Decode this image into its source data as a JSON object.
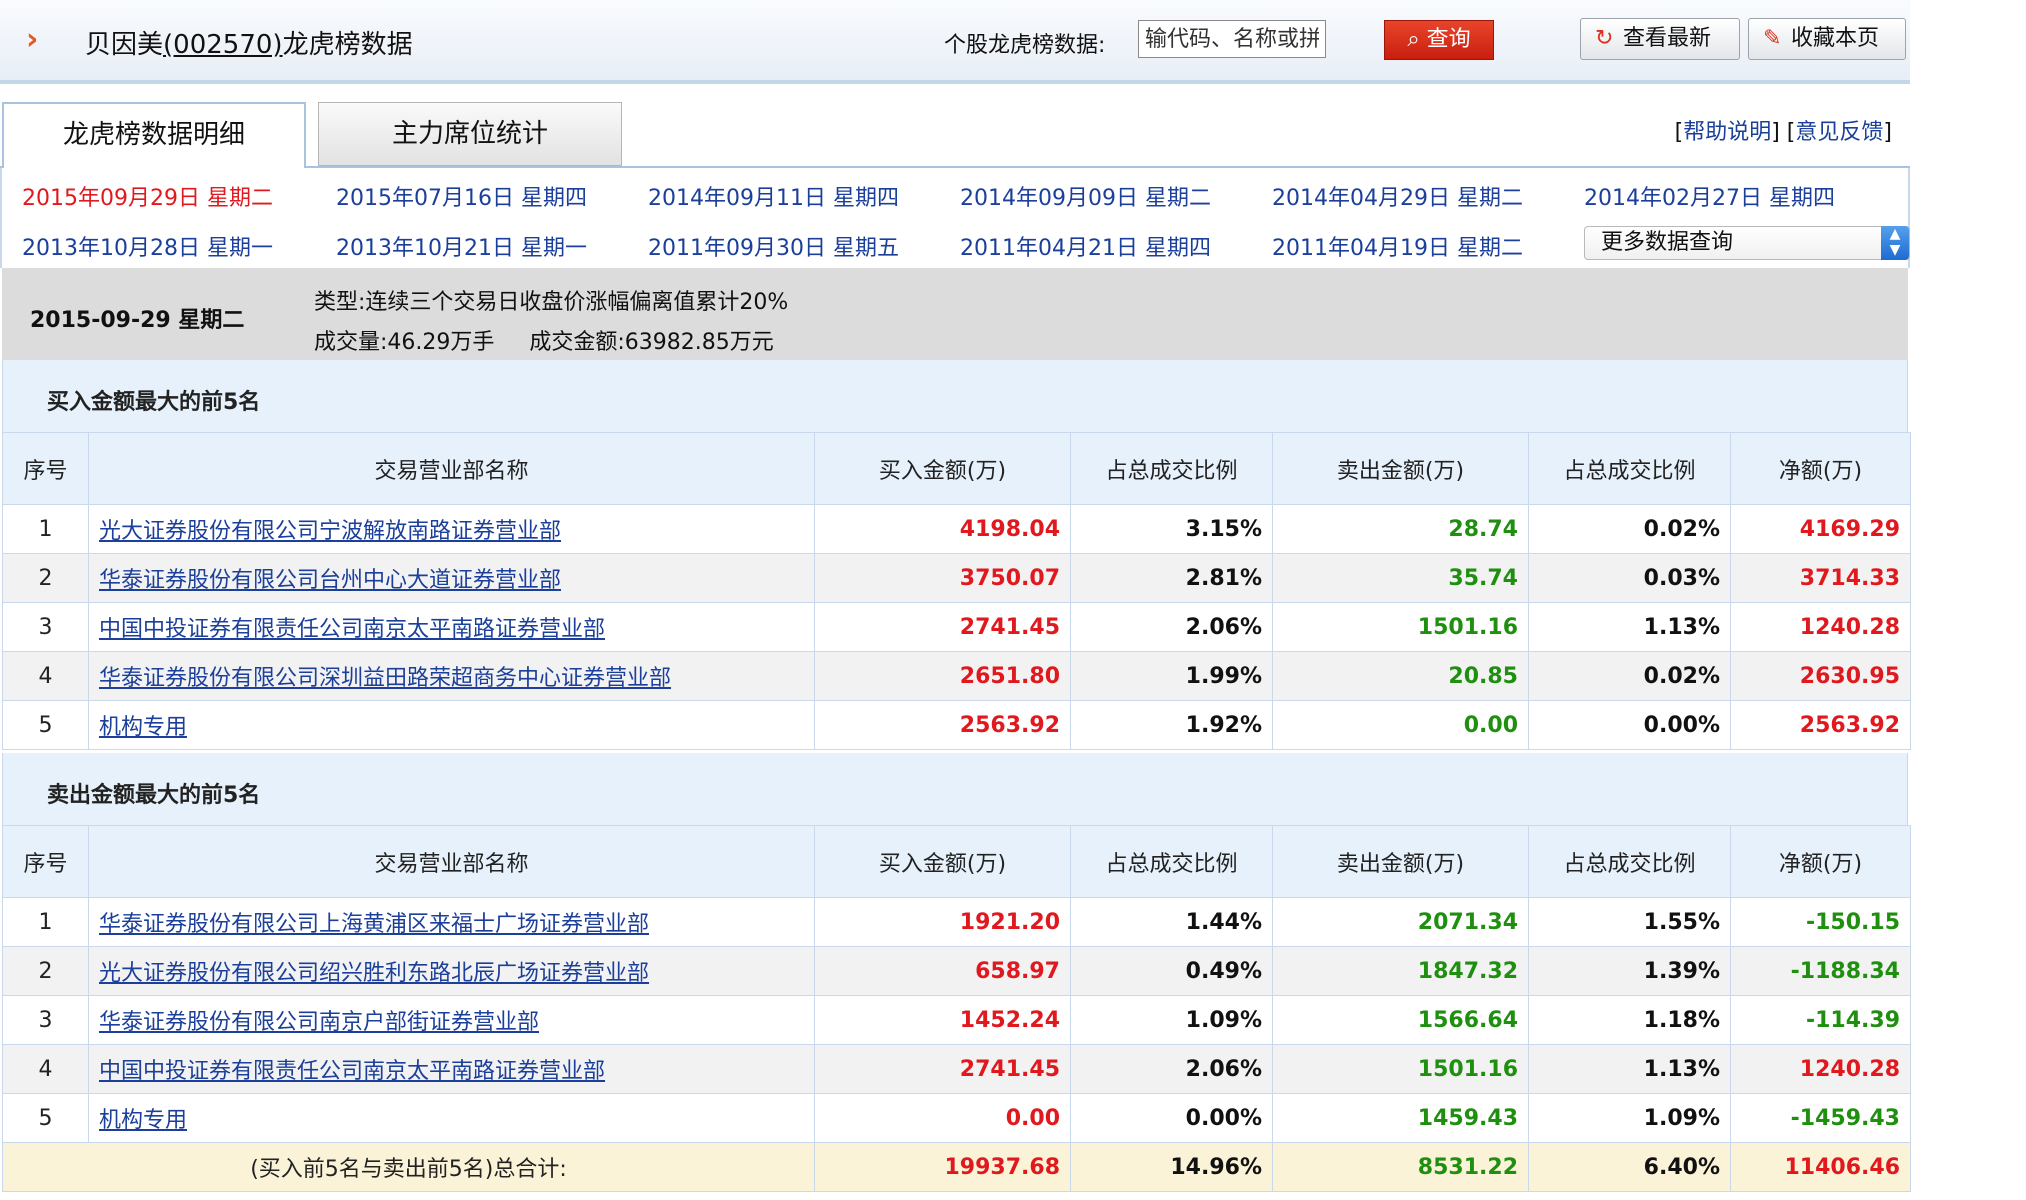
{
  "header": {
    "stock_name": "贝因美",
    "stock_code_paren": "(002570)",
    "title_suffix": "龙虎榜数据",
    "query_label": "个股龙虎榜数据:",
    "query_placeholder": "输代码、名称或拼音",
    "query_button": "查询",
    "refresh_button": "查看最新",
    "bookmark_button": "收藏本页"
  },
  "tabs": [
    {
      "label": "龙虎榜数据明细",
      "active": true
    },
    {
      "label": "主力席位统计",
      "active": false
    }
  ],
  "help": {
    "help_link": "帮助说明",
    "feedback_link": "意见反馈"
  },
  "dates": [
    "2015年09月29日 星期二",
    "2015年07月16日 星期四",
    "2014年09月11日 星期四",
    "2014年09月09日 星期二",
    "2014年04月29日 星期二",
    "2014年02月27日 星期四",
    "2013年10月28日 星期一",
    "2013年10月21日 星期一",
    "2011年09月30日 星期五",
    "2011年04月21日 星期四",
    "2011年04月19日 星期二"
  ],
  "more_select": "更多数据查询",
  "info": {
    "date": "2015-09-29 星期二",
    "type_line": "类型:连续三个交易日收盘价涨幅偏离值累计20%",
    "volume_line": "成交量:46.29万手     成交金额:63982.85万元"
  },
  "columns": [
    "序号",
    "交易营业部名称",
    "买入金额(万)",
    "占总成交比例",
    "卖出金额(万)",
    "占总成交比例",
    "净额(万)"
  ],
  "buy_section": {
    "title": "买入金额最大的前5名",
    "rows": [
      {
        "idx": "1",
        "name": "光大证券股份有限公司宁波解放南路证券营业部",
        "buy": "4198.04",
        "buy_pct": "3.15%",
        "sell": "28.74",
        "sell_pct": "0.02%",
        "net": "4169.29"
      },
      {
        "idx": "2",
        "name": "华泰证券股份有限公司台州中心大道证券营业部",
        "buy": "3750.07",
        "buy_pct": "2.81%",
        "sell": "35.74",
        "sell_pct": "0.03%",
        "net": "3714.33"
      },
      {
        "idx": "3",
        "name": "中国中投证券有限责任公司南京太平南路证券营业部",
        "buy": "2741.45",
        "buy_pct": "2.06%",
        "sell": "1501.16",
        "sell_pct": "1.13%",
        "net": "1240.28"
      },
      {
        "idx": "4",
        "name": "华泰证券股份有限公司深圳益田路荣超商务中心证券营业部",
        "buy": "2651.80",
        "buy_pct": "1.99%",
        "sell": "20.85",
        "sell_pct": "0.02%",
        "net": "2630.95"
      },
      {
        "idx": "5",
        "name": "机构专用",
        "buy": "2563.92",
        "buy_pct": "1.92%",
        "sell": "0.00",
        "sell_pct": "0.00%",
        "net": "2563.92"
      }
    ]
  },
  "sell_section": {
    "title": "卖出金额最大的前5名",
    "rows": [
      {
        "idx": "1",
        "name": "华泰证券股份有限公司上海黄浦区来福士广场证券营业部",
        "buy": "1921.20",
        "buy_pct": "1.44%",
        "sell": "2071.34",
        "sell_pct": "1.55%",
        "net": "-150.15"
      },
      {
        "idx": "2",
        "name": "光大证券股份有限公司绍兴胜利东路北辰广场证券营业部",
        "buy": "658.97",
        "buy_pct": "0.49%",
        "sell": "1847.32",
        "sell_pct": "1.39%",
        "net": "-1188.34"
      },
      {
        "idx": "3",
        "name": "华泰证券股份有限公司南京户部街证券营业部",
        "buy": "1452.24",
        "buy_pct": "1.09%",
        "sell": "1566.64",
        "sell_pct": "1.18%",
        "net": "-114.39"
      },
      {
        "idx": "4",
        "name": "中国中投证券有限责任公司南京太平南路证券营业部",
        "buy": "2741.45",
        "buy_pct": "2.06%",
        "sell": "1501.16",
        "sell_pct": "1.13%",
        "net": "1240.28"
      },
      {
        "idx": "5",
        "name": "机构专用",
        "buy": "0.00",
        "buy_pct": "0.00%",
        "sell": "1459.43",
        "sell_pct": "1.09%",
        "net": "-1459.43"
      }
    ]
  },
  "total": {
    "label": "(买入前5名与卖出前5名)总合计:",
    "buy": "19937.68",
    "buy_pct": "14.96%",
    "sell": "8531.22",
    "sell_pct": "6.40%",
    "net": "11406.46"
  },
  "colors": {
    "buy": "#e0191e",
    "sell": "#1f8f0f",
    "link": "#1b3f9a",
    "accent": "#e25b1c"
  }
}
